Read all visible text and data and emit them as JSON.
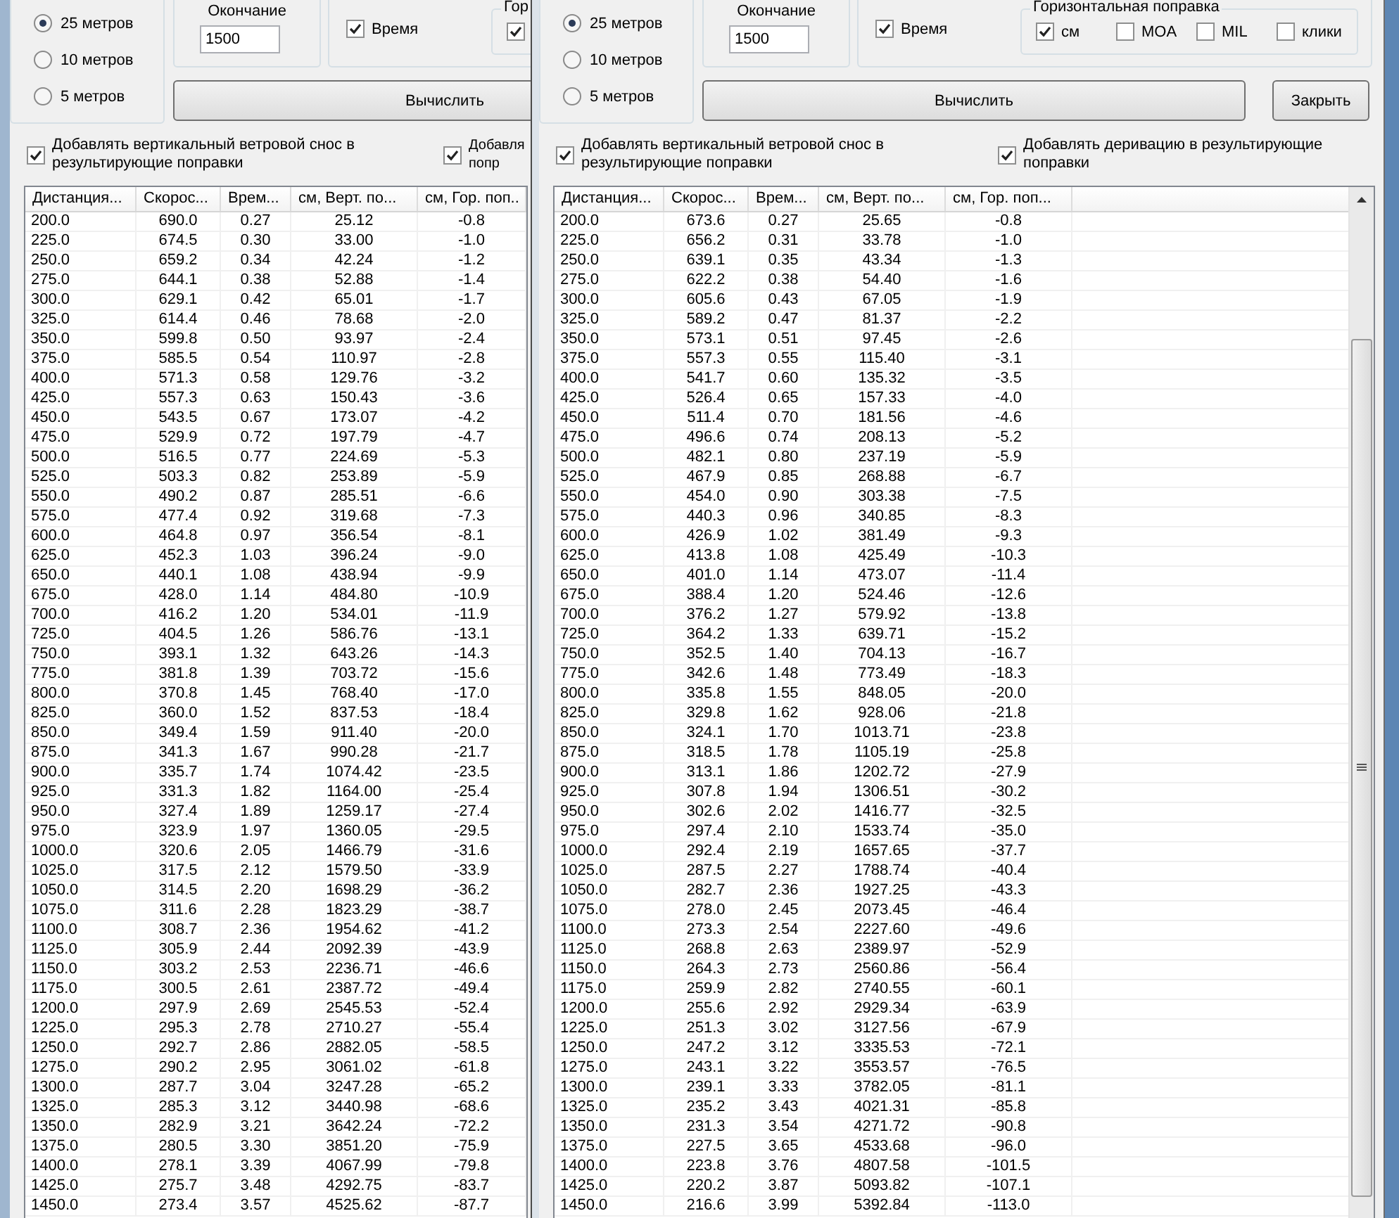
{
  "windows": [
    {
      "kind": "back",
      "radios": [
        {
          "label": "25 метров",
          "selected": true
        },
        {
          "label": "10 метров",
          "selected": false
        },
        {
          "label": "5 метров",
          "selected": false
        }
      ],
      "end_group": {
        "label": "Окончание",
        "value": "1500"
      },
      "time_checkbox": {
        "label": "Время",
        "checked": true
      },
      "horizontal_group": {
        "label": "Гор",
        "options": [
          {
            "checked": true
          }
        ]
      },
      "buttons": [
        "Вычислить"
      ],
      "options": [
        {
          "label": "Добавлять вертикальный ветровой снос в результирующие поправки",
          "checked": true
        },
        {
          "label": "Добавля попр",
          "checked": true
        }
      ],
      "table": {
        "columns": [
          "Дистанция...",
          "Скорос...",
          "Врем...",
          "см, Верт. по...",
          "см, Гор. поп.."
        ],
        "rows": [
          [
            "200.0",
            "690.0",
            "0.27",
            "25.12",
            "-0.8"
          ],
          [
            "225.0",
            "674.5",
            "0.30",
            "33.00",
            "-1.0"
          ],
          [
            "250.0",
            "659.2",
            "0.34",
            "42.24",
            "-1.2"
          ],
          [
            "275.0",
            "644.1",
            "0.38",
            "52.88",
            "-1.4"
          ],
          [
            "300.0",
            "629.1",
            "0.42",
            "65.01",
            "-1.7"
          ],
          [
            "325.0",
            "614.4",
            "0.46",
            "78.68",
            "-2.0"
          ],
          [
            "350.0",
            "599.8",
            "0.50",
            "93.97",
            "-2.4"
          ],
          [
            "375.0",
            "585.5",
            "0.54",
            "110.97",
            "-2.8"
          ],
          [
            "400.0",
            "571.3",
            "0.58",
            "129.76",
            "-3.2"
          ],
          [
            "425.0",
            "557.3",
            "0.63",
            "150.43",
            "-3.6"
          ],
          [
            "450.0",
            "543.5",
            "0.67",
            "173.07",
            "-4.2"
          ],
          [
            "475.0",
            "529.9",
            "0.72",
            "197.79",
            "-4.7"
          ],
          [
            "500.0",
            "516.5",
            "0.77",
            "224.69",
            "-5.3"
          ],
          [
            "525.0",
            "503.3",
            "0.82",
            "253.89",
            "-5.9"
          ],
          [
            "550.0",
            "490.2",
            "0.87",
            "285.51",
            "-6.6"
          ],
          [
            "575.0",
            "477.4",
            "0.92",
            "319.68",
            "-7.3"
          ],
          [
            "600.0",
            "464.8",
            "0.97",
            "356.54",
            "-8.1"
          ],
          [
            "625.0",
            "452.3",
            "1.03",
            "396.24",
            "-9.0"
          ],
          [
            "650.0",
            "440.1",
            "1.08",
            "438.94",
            "-9.9"
          ],
          [
            "675.0",
            "428.0",
            "1.14",
            "484.80",
            "-10.9"
          ],
          [
            "700.0",
            "416.2",
            "1.20",
            "534.01",
            "-11.9"
          ],
          [
            "725.0",
            "404.5",
            "1.26",
            "586.76",
            "-13.1"
          ],
          [
            "750.0",
            "393.1",
            "1.32",
            "643.26",
            "-14.3"
          ],
          [
            "775.0",
            "381.8",
            "1.39",
            "703.72",
            "-15.6"
          ],
          [
            "800.0",
            "370.8",
            "1.45",
            "768.40",
            "-17.0"
          ],
          [
            "825.0",
            "360.0",
            "1.52",
            "837.53",
            "-18.4"
          ],
          [
            "850.0",
            "349.4",
            "1.59",
            "911.40",
            "-20.0"
          ],
          [
            "875.0",
            "341.3",
            "1.67",
            "990.28",
            "-21.7"
          ],
          [
            "900.0",
            "335.7",
            "1.74",
            "1074.42",
            "-23.5"
          ],
          [
            "925.0",
            "331.3",
            "1.82",
            "1164.00",
            "-25.4"
          ],
          [
            "950.0",
            "327.4",
            "1.89",
            "1259.17",
            "-27.4"
          ],
          [
            "975.0",
            "323.9",
            "1.97",
            "1360.05",
            "-29.5"
          ],
          [
            "1000.0",
            "320.6",
            "2.05",
            "1466.79",
            "-31.6"
          ],
          [
            "1025.0",
            "317.5",
            "2.12",
            "1579.50",
            "-33.9"
          ],
          [
            "1050.0",
            "314.5",
            "2.20",
            "1698.29",
            "-36.2"
          ],
          [
            "1075.0",
            "311.6",
            "2.28",
            "1823.29",
            "-38.7"
          ],
          [
            "1100.0",
            "308.7",
            "2.36",
            "1954.62",
            "-41.2"
          ],
          [
            "1125.0",
            "305.9",
            "2.44",
            "2092.39",
            "-43.9"
          ],
          [
            "1150.0",
            "303.2",
            "2.53",
            "2236.71",
            "-46.6"
          ],
          [
            "1175.0",
            "300.5",
            "2.61",
            "2387.72",
            "-49.4"
          ],
          [
            "1200.0",
            "297.9",
            "2.69",
            "2545.53",
            "-52.4"
          ],
          [
            "1225.0",
            "295.3",
            "2.78",
            "2710.27",
            "-55.4"
          ],
          [
            "1250.0",
            "292.7",
            "2.86",
            "2882.05",
            "-58.5"
          ],
          [
            "1275.0",
            "290.2",
            "2.95",
            "3061.02",
            "-61.8"
          ],
          [
            "1300.0",
            "287.7",
            "3.04",
            "3247.28",
            "-65.2"
          ],
          [
            "1325.0",
            "285.3",
            "3.12",
            "3440.98",
            "-68.6"
          ],
          [
            "1350.0",
            "282.9",
            "3.21",
            "3642.24",
            "-72.2"
          ],
          [
            "1375.0",
            "280.5",
            "3.30",
            "3851.20",
            "-75.9"
          ],
          [
            "1400.0",
            "278.1",
            "3.39",
            "4067.99",
            "-79.8"
          ],
          [
            "1425.0",
            "275.7",
            "3.48",
            "4292.75",
            "-83.7"
          ],
          [
            "1450.0",
            "273.4",
            "3.57",
            "4525.62",
            "-87.7"
          ]
        ]
      }
    },
    {
      "kind": "front",
      "radios": [
        {
          "label": "25 метров",
          "selected": true
        },
        {
          "label": "10 метров",
          "selected": false
        },
        {
          "label": "5 метров",
          "selected": false
        }
      ],
      "end_group": {
        "label": "Окончание",
        "value": "1500"
      },
      "time_checkbox": {
        "label": "Время",
        "checked": true
      },
      "horizontal_group": {
        "label": "Горизонтальная поправка",
        "options": [
          {
            "label": "см",
            "checked": true
          },
          {
            "label": "MOA",
            "checked": false
          },
          {
            "label": "MIL",
            "checked": false
          },
          {
            "label": "клики",
            "checked": false
          }
        ]
      },
      "buttons": [
        "Вычислить",
        "Закрыть"
      ],
      "options": [
        {
          "label": "Добавлять вертикальный ветровой снос в результирующие поправки",
          "checked": true
        },
        {
          "label": "Добавлять деривацию в результирующие поправки",
          "checked": true
        }
      ],
      "table": {
        "columns": [
          "Дистанция...",
          "Скорос...",
          "Врем...",
          "см, Верт. по...",
          "см, Гор. поп..."
        ],
        "rows": [
          [
            "200.0",
            "673.6",
            "0.27",
            "25.65",
            "-0.8"
          ],
          [
            "225.0",
            "656.2",
            "0.31",
            "33.78",
            "-1.0"
          ],
          [
            "250.0",
            "639.1",
            "0.35",
            "43.34",
            "-1.3"
          ],
          [
            "275.0",
            "622.2",
            "0.38",
            "54.40",
            "-1.6"
          ],
          [
            "300.0",
            "605.6",
            "0.43",
            "67.05",
            "-1.9"
          ],
          [
            "325.0",
            "589.2",
            "0.47",
            "81.37",
            "-2.2"
          ],
          [
            "350.0",
            "573.1",
            "0.51",
            "97.45",
            "-2.6"
          ],
          [
            "375.0",
            "557.3",
            "0.55",
            "115.40",
            "-3.1"
          ],
          [
            "400.0",
            "541.7",
            "0.60",
            "135.32",
            "-3.5"
          ],
          [
            "425.0",
            "526.4",
            "0.65",
            "157.33",
            "-4.0"
          ],
          [
            "450.0",
            "511.4",
            "0.70",
            "181.56",
            "-4.6"
          ],
          [
            "475.0",
            "496.6",
            "0.74",
            "208.13",
            "-5.2"
          ],
          [
            "500.0",
            "482.1",
            "0.80",
            "237.19",
            "-5.9"
          ],
          [
            "525.0",
            "467.9",
            "0.85",
            "268.88",
            "-6.7"
          ],
          [
            "550.0",
            "454.0",
            "0.90",
            "303.38",
            "-7.5"
          ],
          [
            "575.0",
            "440.3",
            "0.96",
            "340.85",
            "-8.3"
          ],
          [
            "600.0",
            "426.9",
            "1.02",
            "381.49",
            "-9.3"
          ],
          [
            "625.0",
            "413.8",
            "1.08",
            "425.49",
            "-10.3"
          ],
          [
            "650.0",
            "401.0",
            "1.14",
            "473.07",
            "-11.4"
          ],
          [
            "675.0",
            "388.4",
            "1.20",
            "524.46",
            "-12.6"
          ],
          [
            "700.0",
            "376.2",
            "1.27",
            "579.92",
            "-13.8"
          ],
          [
            "725.0",
            "364.2",
            "1.33",
            "639.71",
            "-15.2"
          ],
          [
            "750.0",
            "352.5",
            "1.40",
            "704.13",
            "-16.7"
          ],
          [
            "775.0",
            "342.6",
            "1.48",
            "773.49",
            "-18.3"
          ],
          [
            "800.0",
            "335.8",
            "1.55",
            "848.05",
            "-20.0"
          ],
          [
            "825.0",
            "329.8",
            "1.62",
            "928.06",
            "-21.8"
          ],
          [
            "850.0",
            "324.1",
            "1.70",
            "1013.71",
            "-23.8"
          ],
          [
            "875.0",
            "318.5",
            "1.78",
            "1105.19",
            "-25.8"
          ],
          [
            "900.0",
            "313.1",
            "1.86",
            "1202.72",
            "-27.9"
          ],
          [
            "925.0",
            "307.8",
            "1.94",
            "1306.51",
            "-30.2"
          ],
          [
            "950.0",
            "302.6",
            "2.02",
            "1416.77",
            "-32.5"
          ],
          [
            "975.0",
            "297.4",
            "2.10",
            "1533.74",
            "-35.0"
          ],
          [
            "1000.0",
            "292.4",
            "2.19",
            "1657.65",
            "-37.7"
          ],
          [
            "1025.0",
            "287.5",
            "2.27",
            "1788.74",
            "-40.4"
          ],
          [
            "1050.0",
            "282.7",
            "2.36",
            "1927.25",
            "-43.3"
          ],
          [
            "1075.0",
            "278.0",
            "2.45",
            "2073.45",
            "-46.4"
          ],
          [
            "1100.0",
            "273.3",
            "2.54",
            "2227.60",
            "-49.6"
          ],
          [
            "1125.0",
            "268.8",
            "2.63",
            "2389.97",
            "-52.9"
          ],
          [
            "1150.0",
            "264.3",
            "2.73",
            "2560.86",
            "-56.4"
          ],
          [
            "1175.0",
            "259.9",
            "2.82",
            "2740.55",
            "-60.1"
          ],
          [
            "1200.0",
            "255.6",
            "2.92",
            "2929.34",
            "-63.9"
          ],
          [
            "1225.0",
            "251.3",
            "3.02",
            "3127.56",
            "-67.9"
          ],
          [
            "1250.0",
            "247.2",
            "3.12",
            "3335.53",
            "-72.1"
          ],
          [
            "1275.0",
            "243.1",
            "3.22",
            "3553.57",
            "-76.5"
          ],
          [
            "1300.0",
            "239.1",
            "3.33",
            "3782.05",
            "-81.1"
          ],
          [
            "1325.0",
            "235.2",
            "3.43",
            "4021.31",
            "-85.8"
          ],
          [
            "1350.0",
            "231.3",
            "3.54",
            "4271.72",
            "-90.8"
          ],
          [
            "1375.0",
            "227.5",
            "3.65",
            "4533.68",
            "-96.0"
          ],
          [
            "1400.0",
            "223.8",
            "3.76",
            "4807.58",
            "-101.5"
          ],
          [
            "1425.0",
            "220.2",
            "3.87",
            "5093.82",
            "-107.1"
          ],
          [
            "1450.0",
            "216.6",
            "3.99",
            "5392.84",
            "-113.0"
          ]
        ]
      }
    }
  ]
}
